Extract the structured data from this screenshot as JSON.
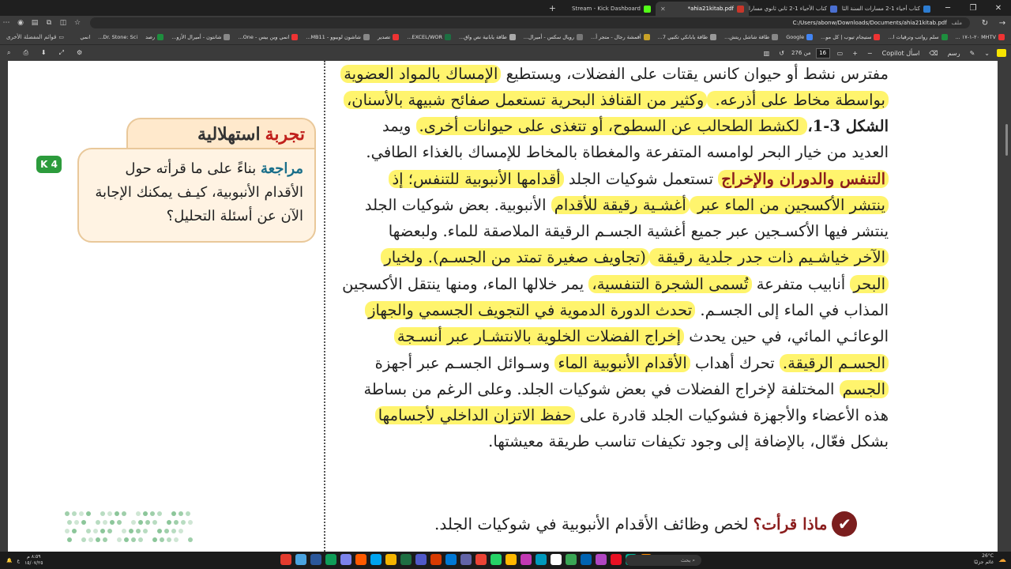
{
  "browser": {
    "tabs": [
      {
        "label": "كتاب أحياء 1-2 مسارات السنة الثانية",
        "color": "#2d7dd2",
        "active": false
      },
      {
        "label": "كتاب الأحياء 1-2 ثاني ثانوي مسارات",
        "color": "#4a6fd1",
        "active": false
      },
      {
        "label": "ahia21kitab.pdf*",
        "color": "#c8362a",
        "active": true
      },
      {
        "label": "Stream - Kick Dashboard",
        "color": "#53fc18",
        "active": false
      }
    ],
    "address": {
      "label": "ملف",
      "url": "C:/Users/abonw/Downloads/Documents/ahia21kitab.pdf"
    },
    "bookmarks": [
      "MHTV ٢٠-١-١٧ ...",
      "سلم رواتب وترقيات ا...",
      "ستيجام تيوب | كل مو...",
      "Google",
      "طاقة شاشل ريتش...",
      "طاقة يابانكي تكنيي 7...",
      "أقمشة رجال - متجر أ...",
      "رويال سكس - أميرال...",
      "طاقة يابانية نص واق...",
      "EXCEL/WOR...",
      "تصدير",
      "شاشون لوبيوو - MB11...",
      "انمي وين بيس - One...",
      "شانتون - أميرال الأزو...",
      "رصد",
      "Dr. Stone: Sci...",
      "انمي"
    ],
    "bookmarks_more": "قوائم المفضلة الأخرى"
  },
  "pdf_toolbar": {
    "draw_label": "رسم",
    "ask_copilot": "اسأل Copilot",
    "page_current": "16",
    "page_total": "من 276"
  },
  "document": {
    "lines": [
      [
        {
          "t": "مفترس نشط أو حيوان كانس يقتات على الفضلات، ويستطيع "
        },
        {
          "t": "الإمساك بالمواد العضوية",
          "hl": true
        }
      ],
      [
        {
          "t": "بواسطة مخاط على أذرعه. ",
          "hl": true
        },
        {
          "t": "وكثير من القنافذ البحرية تستعمل صفائح شبيهة بالأسنان،",
          "hl": true
        }
      ],
      [
        {
          "t": "الشكل 3-1،",
          "bold": true
        },
        {
          "t": " لكشط الطحالب عن السطوح، أو تتغذى على حيوانات أخرى.",
          "hl": true
        },
        {
          "t": " ويمد"
        }
      ],
      [
        {
          "t": "العديد من خيار البحر لوامسه المتفرعة والمغطاة بالمخاط للإمساك بالغذاء الطافي."
        }
      ],
      [
        {
          "t": "التنفس والدوران والإخراج",
          "heading": true,
          "hl": true
        },
        {
          "t": "  تستعمل شوكيات الجلد "
        },
        {
          "t": "أقدامها الأنبوبية للتنفس؛ إذ",
          "hl": true
        }
      ],
      [
        {
          "t": "ينتشر الأكسجين من الماء عبر ",
          "hl": true
        },
        {
          "t": "أغشـية رقيقة للأقدام",
          "hl": true
        },
        {
          "t": " الأنبوبية. بعض شوكيات الجلد"
        }
      ],
      [
        {
          "t": "ينتشر فيها الأكسـجين عبر جميع أغشية الجسـم الرقيقة الملاصقة للماء. ولبعضها"
        }
      ],
      [
        {
          "t": "الآخر خياشـيم ذات جدر جلدية رقيقة ",
          "hl": true
        },
        {
          "t": "(تجاويف صغيرة تمتد من الجسـم). ولخيار",
          "hl": true
        }
      ],
      [
        {
          "t": "البحر",
          "hl": true
        },
        {
          "t": " أنابيب متفرعة "
        },
        {
          "t": "تُسمى الشجرة التنفسية،",
          "hl": true
        },
        {
          "t": " يمر خلالها الماء، ومنها ينتقل الأكسجين"
        }
      ],
      [
        {
          "t": "المذاب في الماء إلى الجسـم. "
        },
        {
          "t": "تحدث الدورة الدموية في التجويف الجسمي والجهاز",
          "hl": true
        }
      ],
      [
        {
          "t": "الوعائـي المائي، في حين يحدث "
        },
        {
          "t": "إخراج الفضلات الخلوية بالانتشـار عبر أنسـجة",
          "hl": true
        }
      ],
      [
        {
          "t": "الجسـم الرقيقة.",
          "hl": true
        },
        {
          "t": " تحرك أهداب "
        },
        {
          "t": "الأقدام الأنبوبية الماء",
          "hl": true
        },
        {
          "t": " وسـوائل الجسـم عبر أجهزة"
        }
      ],
      [
        {
          "t": "الجسم",
          "hl": true
        },
        {
          "t": " المختلفة لإخراج الفضلات في بعض شوكيات الجلد. وعلى الرغم من بساطة"
        }
      ],
      [
        {
          "t": "هذه الأعضاء والأجهزة فشوكيات الجلد قادرة على "
        },
        {
          "t": "حفظ الاتزان الداخلي لأجسامها",
          "hl": true
        }
      ],
      [
        {
          "t": "بشكل فعّال، بالإضافة إلى وجود تكيفات تناسب طريقة معيشتها."
        }
      ]
    ],
    "question_title": "ماذا قرأت؟",
    "question_text": "لخص وظائف الأقدام الأنبوبية في شوكيات الجلد."
  },
  "side_card": {
    "title_red": "تجربة",
    "title_black": "استهلالية",
    "keyword": "مراجعة",
    "text": "بناءً على ما قرأته حول الأقدام الأنبوبية، كيـف يمكنك الإجابة الآن عن أسئلة التحليل؟",
    "badge": "4"
  },
  "taskbar": {
    "search_placeholder": "بحث",
    "weather_temp": "26°C",
    "weather_desc": "غائم جزئيًا",
    "time": "٨:٥٩ م",
    "date": "١٥/٠٧/٢٥"
  }
}
